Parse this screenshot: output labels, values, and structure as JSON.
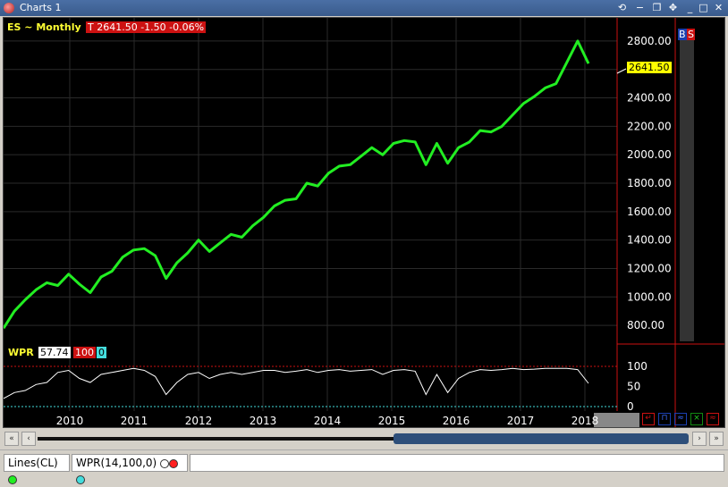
{
  "window": {
    "title": "Charts 1"
  },
  "chart": {
    "symbol_label": "ES ~ Monthly",
    "last_quote": "T 2641.50  -1.50  -0.06%",
    "price_tag": "2641.50",
    "price_axis": [
      "2800.00",
      "2600.00",
      "2400.00",
      "2200.00",
      "2000.00",
      "1800.00",
      "1600.00",
      "1400.00",
      "1200.00",
      "1000.00",
      "800.00"
    ],
    "buy_label": "B",
    "sell_label": "S",
    "wpr_label": "WPR",
    "wpr_value": "57.74",
    "wpr_level_high": "100",
    "wpr_level_low": "0",
    "wpr_axis": [
      "100",
      "50",
      "0"
    ],
    "years": [
      "2010",
      "2011",
      "2012",
      "2013",
      "2014",
      "2015",
      "2016",
      "2017",
      "2018"
    ],
    "colors": {
      "price_line": "#22ee22",
      "wpr_line": "#ffffff",
      "grid": "#2a2a2a",
      "highlight": "#cc1111"
    }
  },
  "status": {
    "lines_label": "Lines(CL)",
    "wpr_params": "WPR(14,100,0)"
  },
  "chart_data": [
    {
      "type": "line",
      "title": "ES ~ Monthly",
      "series": [
        {
          "name": "ES ~ Monthly",
          "x": [
            "2009-03",
            "2009-05",
            "2009-07",
            "2009-09",
            "2009-11",
            "2010-01",
            "2010-03",
            "2010-05",
            "2010-07",
            "2010-09",
            "2010-11",
            "2011-01",
            "2011-03",
            "2011-05",
            "2011-07",
            "2011-09",
            "2011-11",
            "2012-01",
            "2012-03",
            "2012-05",
            "2012-07",
            "2012-09",
            "2012-11",
            "2013-01",
            "2013-03",
            "2013-05",
            "2013-07",
            "2013-09",
            "2013-11",
            "2014-01",
            "2014-03",
            "2014-05",
            "2014-07",
            "2014-09",
            "2014-11",
            "2015-01",
            "2015-03",
            "2015-05",
            "2015-07",
            "2015-09",
            "2015-11",
            "2016-01",
            "2016-03",
            "2016-05",
            "2016-07",
            "2016-09",
            "2016-11",
            "2017-01",
            "2017-03",
            "2017-05",
            "2017-07",
            "2017-09",
            "2017-11",
            "2018-01",
            "2018-03"
          ],
          "values": [
            780,
            900,
            980,
            1050,
            1100,
            1080,
            1160,
            1090,
            1030,
            1140,
            1180,
            1280,
            1330,
            1340,
            1290,
            1130,
            1240,
            1310,
            1400,
            1320,
            1380,
            1440,
            1420,
            1500,
            1560,
            1640,
            1680,
            1690,
            1800,
            1780,
            1870,
            1920,
            1930,
            1990,
            2050,
            2000,
            2080,
            2100,
            2090,
            1930,
            2080,
            1940,
            2050,
            2090,
            2170,
            2160,
            2200,
            2280,
            2360,
            2410,
            2470,
            2500,
            2650,
            2800,
            2641.5
          ]
        }
      ],
      "ylim": [
        700,
        2900
      ]
    },
    {
      "type": "line",
      "title": "WPR",
      "series": [
        {
          "name": "WPR",
          "values": [
            20,
            35,
            40,
            55,
            60,
            85,
            90,
            70,
            60,
            80,
            85,
            90,
            95,
            90,
            75,
            30,
            60,
            80,
            85,
            70,
            80,
            85,
            80,
            85,
            90,
            90,
            85,
            88,
            92,
            85,
            90,
            92,
            88,
            90,
            92,
            80,
            90,
            92,
            88,
            30,
            80,
            35,
            70,
            85,
            92,
            90,
            92,
            95,
            92,
            93,
            95,
            95,
            95,
            92,
            57.74
          ]
        }
      ],
      "ylim": [
        0,
        100
      ]
    }
  ]
}
